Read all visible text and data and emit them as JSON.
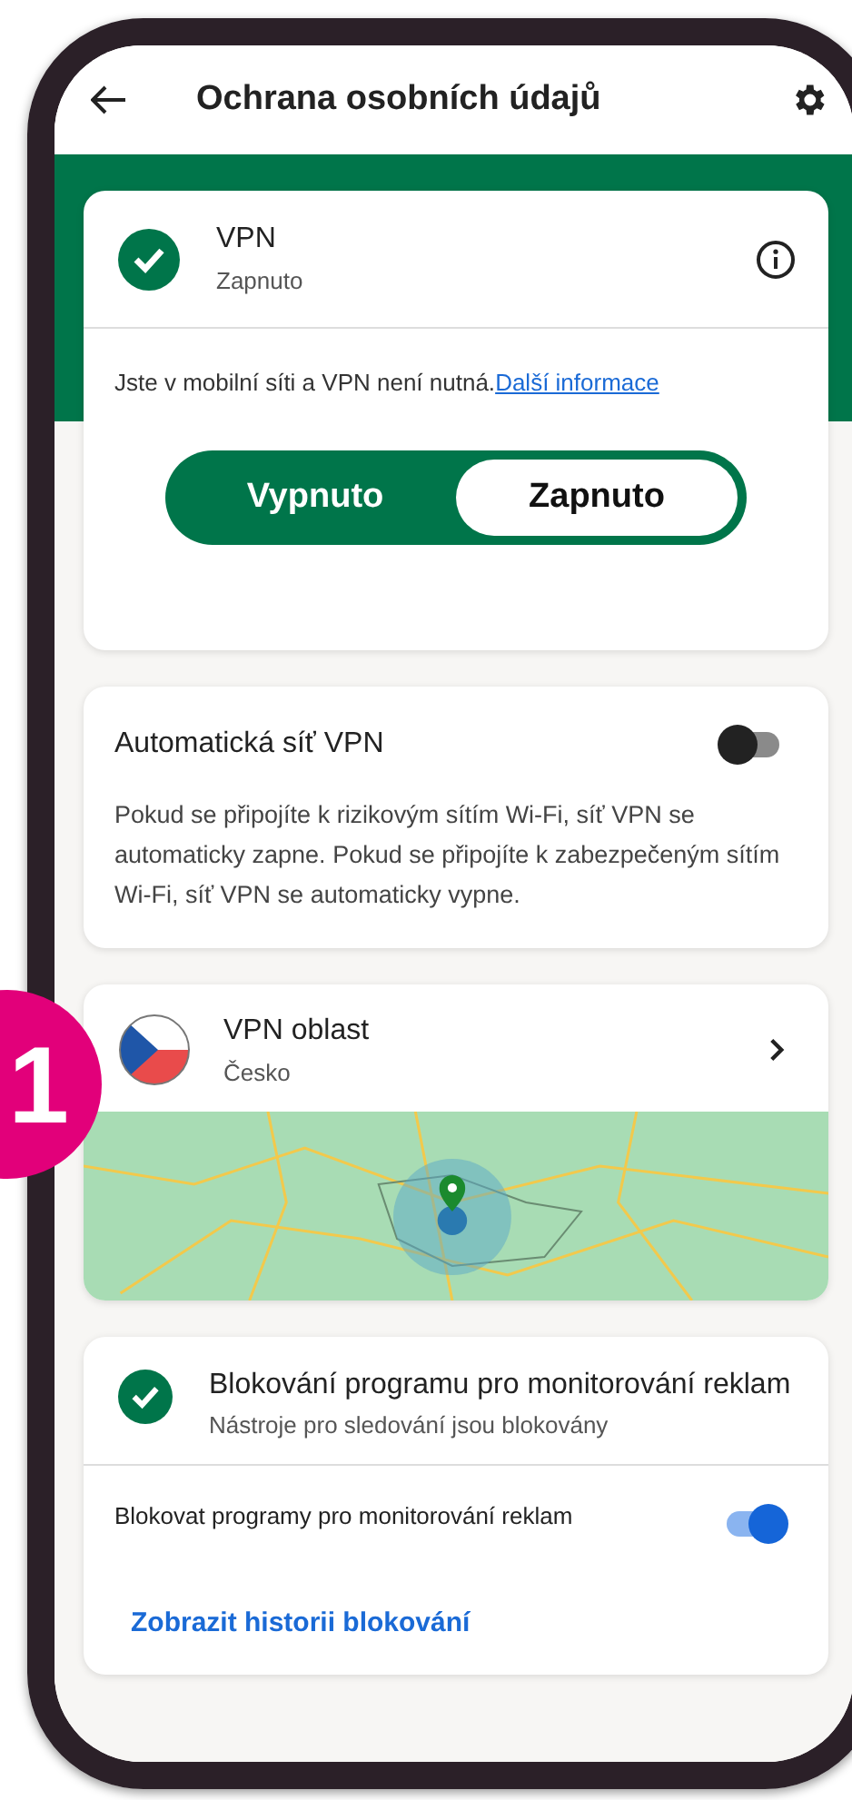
{
  "header": {
    "title": "Ochrana osobních údajů"
  },
  "vpn_card": {
    "title": "VPN",
    "status": "Zapnuto",
    "enabled": true,
    "info": "Jste v mobilní síti a VPN není nutná.",
    "link": "Další informace",
    "segments": [
      {
        "label": "Vypnuto",
        "selected": false
      },
      {
        "label": "Zapnuto",
        "selected": true
      }
    ]
  },
  "auto_vpn": {
    "title": "Automatická síť VPN",
    "on": false,
    "description": "Pokud se připojíte k rizikovým sítím Wi-Fi, síť VPN se automaticky zapne. Pokud se připojíte k zabezpečeným sítím Wi-Fi, síť VPN se automaticky vypne."
  },
  "vpn_region": {
    "title": "VPN oblast",
    "country": "Česko"
  },
  "tracker_card": {
    "title": "Blokování programu pro monitorování reklam",
    "status": "Nástroje pro sledování jsou blokovány",
    "enabled": true,
    "toggle_label": "Blokovat programy pro monitorování reklam",
    "toggle_on": true,
    "link": "Zobrazit historii blokování"
  },
  "callout": {
    "number": "1"
  }
}
